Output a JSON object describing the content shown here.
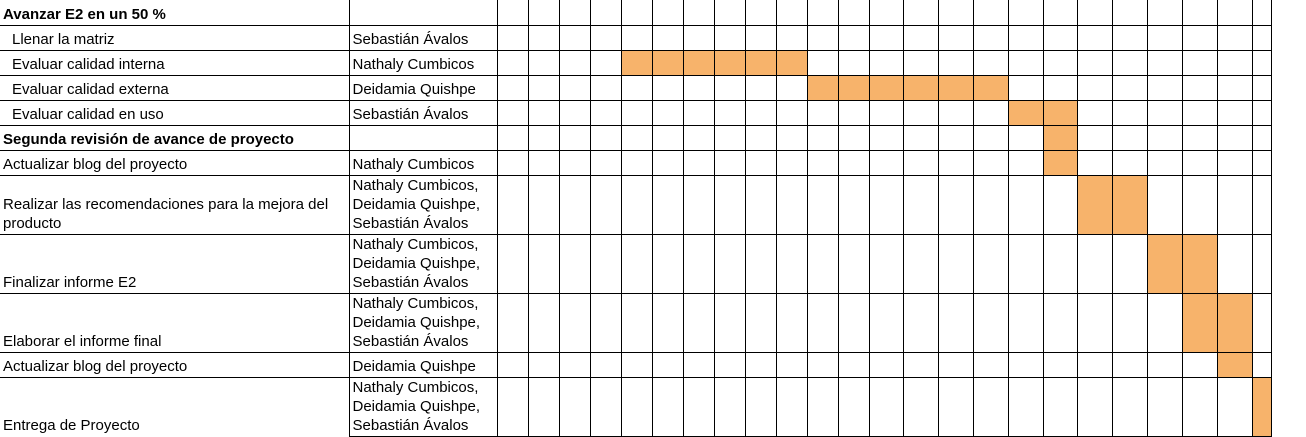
{
  "colors": {
    "bar": "#f7b36b",
    "grid": "#000000"
  },
  "day_columns": 24,
  "rows": [
    {
      "task": "Avanzar E2 en un 50 %",
      "style": "bold",
      "responsible": [],
      "active": []
    },
    {
      "task": "Llenar la matriz",
      "style": "sub",
      "responsible": [
        "Sebastián Ávalos"
      ],
      "active": []
    },
    {
      "task": "Evaluar calidad interna",
      "style": "sub",
      "responsible": [
        "Nathaly Cumbicos"
      ],
      "active": [
        5,
        6,
        7,
        8,
        9,
        10
      ]
    },
    {
      "task": "Evaluar calidad externa",
      "style": "sub",
      "responsible": [
        "Deidamia Quishpe"
      ],
      "active": [
        11,
        12,
        13,
        14,
        15,
        16
      ]
    },
    {
      "task": "Evaluar calidad en uso",
      "style": "sub",
      "responsible": [
        "Sebastián Ávalos"
      ],
      "active": [
        17,
        18
      ]
    },
    {
      "task": "Segunda revisión de avance de proyecto",
      "style": "bold",
      "responsible": [],
      "active": [
        18
      ]
    },
    {
      "task": "Actualizar blog del proyecto",
      "style": "normal",
      "responsible": [
        "Nathaly Cumbicos"
      ],
      "active": [
        18
      ]
    },
    {
      "task": "Realizar las recomendaciones para la mejora del producto",
      "style": "normal",
      "responsible": [
        "Nathaly Cumbicos,",
        "Deidamia Quishpe,",
        "Sebastián Ávalos"
      ],
      "active": [
        19,
        20
      ]
    },
    {
      "task": "Finalizar informe E2",
      "style": "normal",
      "responsible": [
        "Nathaly Cumbicos,",
        "Deidamia Quishpe,",
        "Sebastián Ávalos"
      ],
      "active": [
        21,
        22
      ]
    },
    {
      "task": "Elaborar el informe final",
      "style": "normal",
      "responsible": [
        "Nathaly Cumbicos,",
        "Deidamia Quishpe,",
        "Sebastián Ávalos"
      ],
      "active": [
        22,
        23
      ]
    },
    {
      "task": "Actualizar blog del proyecto",
      "style": "normal",
      "responsible": [
        "Deidamia Quishpe"
      ],
      "active": [
        23
      ]
    },
    {
      "task": "Entrega de Proyecto",
      "style": "normal",
      "responsible": [
        "Nathaly Cumbicos,",
        "Deidamia Quishpe,",
        "Sebastián Ávalos"
      ],
      "active": [
        24
      ]
    }
  ]
}
